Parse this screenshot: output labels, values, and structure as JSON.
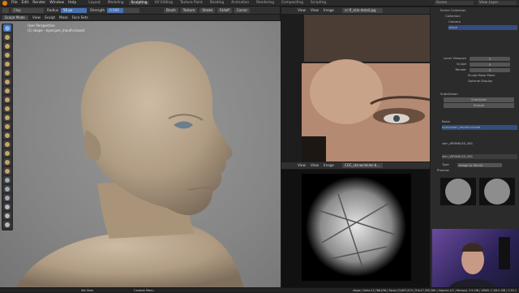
{
  "menu": {
    "items": [
      "File",
      "Edit",
      "Render",
      "Window",
      "Help"
    ],
    "workspaces": [
      "Layout",
      "Modeling",
      "Sculpting",
      "UV Editing",
      "Texture Paint",
      "Shading",
      "Animation",
      "Rendering",
      "Compositing",
      "Scripting"
    ],
    "active_workspace": "Sculpting",
    "scene": "Scene",
    "view_layer": "View Layer"
  },
  "tool_header": {
    "brush": "Clay",
    "radius_label": "Radius",
    "radius_value": "50 px",
    "strength_label": "Strength",
    "strength_value": "0.500",
    "buttons": [
      "Brush",
      "Texture",
      "Stroke",
      "Falloff",
      "Cursor"
    ]
  },
  "viewport_header": {
    "mode": "Sculpt Mode",
    "menus": [
      "View",
      "Sculpt",
      "Mask",
      "Face Sets"
    ]
  },
  "viewport": {
    "view_name": "User Perspective",
    "object_line": "(1) skope - eyes:pen_mouth:closed"
  },
  "image_editor_top": {
    "menus": [
      "View",
      "View",
      "Image"
    ],
    "image_name": "cc-fl_skin-detail.jpg"
  },
  "image_editor_bottom": {
    "menus": [
      "View",
      "View",
      "Image"
    ],
    "image_name": "CGC_skinwrinkles-b..."
  },
  "outliner": {
    "title": "Scene Collection",
    "items": [
      "Collection",
      "Camera",
      "skope"
    ]
  },
  "properties": {
    "multires_levels": [
      "Level Viewport",
      "Sculpt",
      "Render"
    ],
    "level_values": [
      "5",
      "5",
      "5"
    ],
    "sculpt_base_mesh": "Sculpt Base Mesh",
    "optimal_display": "Optimal Display",
    "subdivision_label": "Subdivision",
    "subdivide_button": "Subdivide",
    "simple_button": "Simple",
    "basis_label": "Basis",
    "shape_key": "eyes:open_mouth:closed",
    "texture_name": "skin_WRINKLES_BIG",
    "brush_texture": "skin_WRINKLES_BIG",
    "type_label": "Type",
    "type_value": "Image or Movie",
    "preview_label": "Preview"
  },
  "statusbar": {
    "left": "Set View",
    "middle": "Context Menu",
    "right": "skope | Verts:13,766,036 | Faces:13,697,874 | Tris:27,395,360 | Objects:1/3 | Memory: 3.9 GiB | VRAM: 2.3/8.0 GiB | 2.93.1"
  }
}
